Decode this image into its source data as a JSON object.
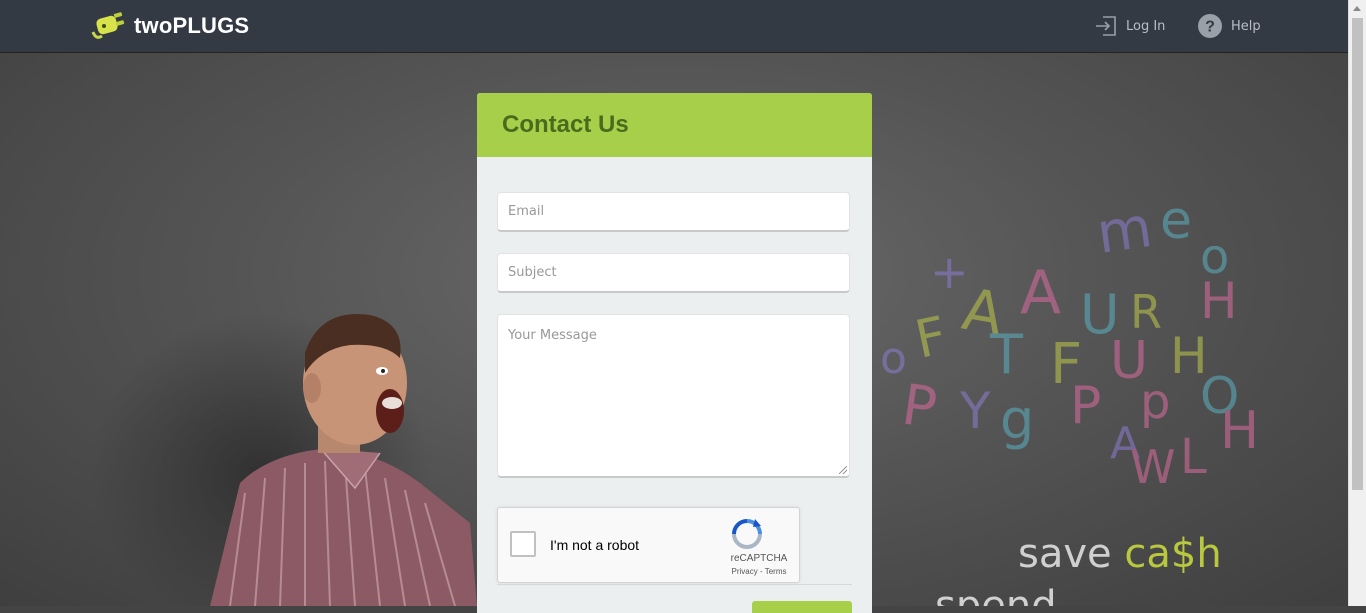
{
  "header": {
    "brand": "twoPLUGS",
    "login_label": "Log In",
    "help_label": "Help"
  },
  "contact": {
    "title": "Contact Us",
    "email_placeholder": "Email",
    "subject_placeholder": "Subject",
    "message_placeholder": "Your Message"
  },
  "captcha": {
    "label": "I'm not a robot",
    "brand": "reCAPTCHA",
    "links": "Privacy - Terms"
  },
  "background": {
    "slogan_save": "save",
    "slogan_cash": "ca$h",
    "slogan_spend": "spend"
  },
  "colors": {
    "accent": "#a8cf4a",
    "header_bg": "#343a44",
    "title_text": "#4a6b1e"
  },
  "icons": {
    "login": "login-arrow-icon",
    "help": "question-circle-icon",
    "logo": "plug-icon",
    "captcha": "recaptcha-icon"
  }
}
